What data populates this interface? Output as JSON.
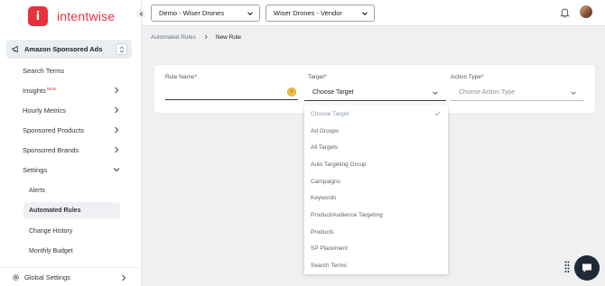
{
  "app": {
    "brand": "intentwise",
    "logo_letter": "i"
  },
  "sidebar": {
    "section": "Amazon Sponsored Ads",
    "items": [
      {
        "label": "Search Terms"
      },
      {
        "label": "Insights",
        "badge": "NEW"
      },
      {
        "label": "Hourly Metrics"
      },
      {
        "label": "Sponsored Products"
      },
      {
        "label": "Sponsored Brands"
      },
      {
        "label": "Settings"
      }
    ],
    "settings_children": [
      {
        "label": "Alerts"
      },
      {
        "label": "Automated Rules"
      },
      {
        "label": "Change History"
      },
      {
        "label": "Monthly Budget"
      }
    ],
    "global_settings": "Global Settings"
  },
  "topbar": {
    "account_select": "Demo - Wiser Drones",
    "profile_select": "Wiser Drones - Vendor"
  },
  "breadcrumb": {
    "parent": "Automated Rules",
    "current": "New Rule"
  },
  "form": {
    "rule_name_label": "Rule Name*",
    "rule_name_value": "",
    "target_label": "Target*",
    "target_value": "Choose Target",
    "action_label": "Action Type*",
    "action_placeholder": "Choose Action Type"
  },
  "dropdown": {
    "options": [
      "Choose Target",
      "Ad Groups",
      "All Targets",
      "Auto Targeting Group",
      "Campaigns",
      "Keywords",
      "Product/Audience Targeting",
      "Products",
      "SP Placement",
      "Search Terms"
    ],
    "selected_index": 0
  },
  "colors": {
    "brand": "#e8313c",
    "chat": "#1f2a36",
    "active_bg": "#eef0f3"
  }
}
